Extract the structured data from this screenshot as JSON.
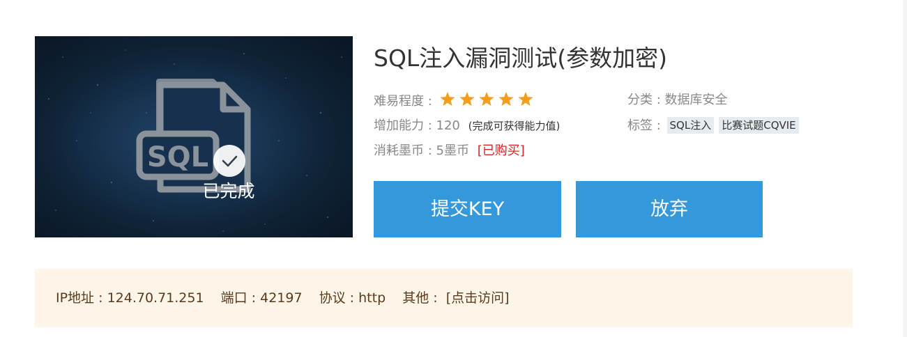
{
  "challenge": {
    "title": "SQL注入漏洞测试(参数加密)",
    "status_label": "已完成",
    "difficulty_label": "难易程度 :",
    "difficulty_stars": 5,
    "ability_label": "增加能力 :",
    "ability_value": "120",
    "ability_note": "(完成可获得能力值)",
    "cost_label": "消耗墨币 :",
    "cost_value": "5墨币",
    "purchased_label": "[已购买]",
    "category_label": "分类 :",
    "category_value": "数据库安全",
    "tags_label": "标签 :",
    "tags": [
      "SQL注入",
      "比赛试题CQVIE"
    ]
  },
  "cover": {
    "art_text": "SQL"
  },
  "actions": {
    "submit_label": "提交KEY",
    "abandon_label": "放弃"
  },
  "connection": {
    "ip_label": "IP地址 :",
    "ip_value": "124.70.71.251",
    "port_label": "端口 :",
    "port_value": "42197",
    "protocol_label": "协议 :",
    "protocol_value": "http",
    "other_label": "其他 :",
    "visit_link": "[点击访问]"
  },
  "colors": {
    "accent_button": "#3498db",
    "star": "#f59c1a",
    "purchased": "#e02020",
    "info_bg": "#fdf6e8",
    "info_text": "#5a3a1c"
  },
  "icons": {
    "cover_icon": "sql-file-icon",
    "badge_icon": "checkmark-icon",
    "rating_icon": "star-icon"
  }
}
